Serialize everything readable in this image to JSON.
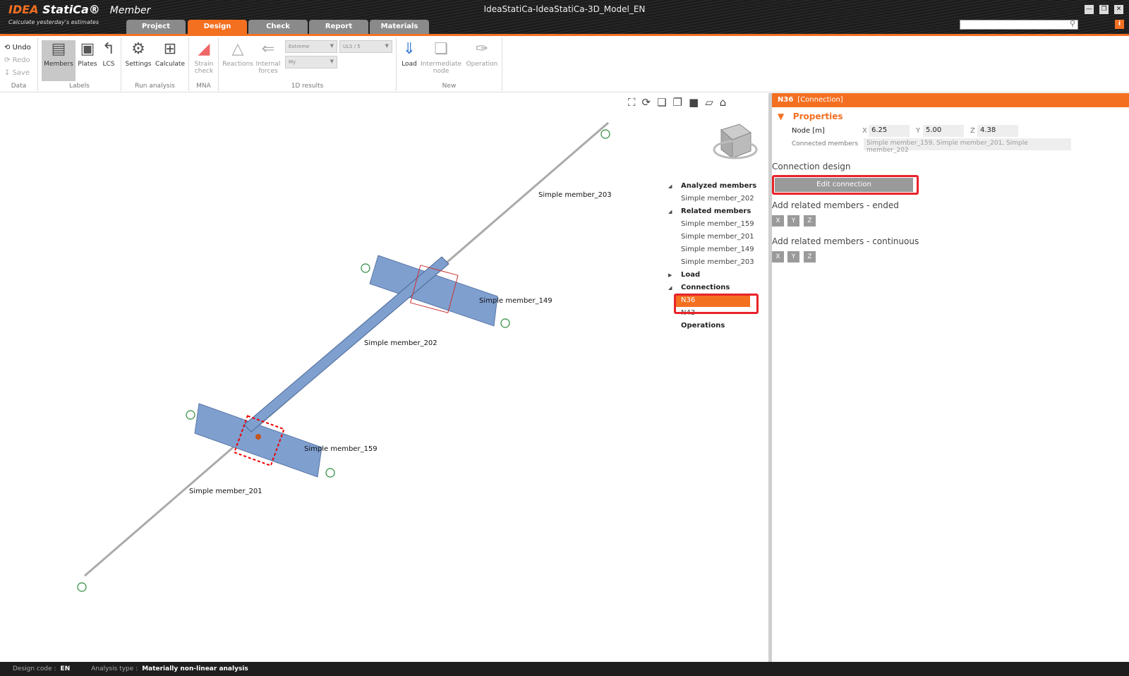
{
  "app": {
    "brand_idea": "IDEA",
    "brand_statica": "StatiCa®",
    "product": "Member",
    "tagline": "Calculate yesterday's estimates",
    "title": "IdeaStatiCa-IdeaStatiCa-3D_Model_EN"
  },
  "tabs": [
    {
      "label": "Project"
    },
    {
      "label": "Design"
    },
    {
      "label": "Check"
    },
    {
      "label": "Report"
    },
    {
      "label": "Materials"
    }
  ],
  "ribbon": {
    "data": {
      "undo": "Undo",
      "redo": "Redo",
      "save": "Save",
      "label": "Data"
    },
    "labels": {
      "members": "Members",
      "plates": "Plates",
      "lcs": "LCS",
      "label": "Labels"
    },
    "run": {
      "settings": "Settings",
      "calculate": "Calculate",
      "label": "Run analysis"
    },
    "mna": {
      "strain1": "Strain",
      "strain2": "check",
      "label": "MNA"
    },
    "results": {
      "reactions": "Reactions",
      "internal1": "Internal",
      "internal2": "forces",
      "dd1": "Extreme",
      "dd2": "ULS / 5",
      "dd3": "My",
      "label": "1D results"
    },
    "new": {
      "load": "Load",
      "inter1": "Intermediate",
      "inter2": "node",
      "operation": "Operation",
      "label": "New"
    }
  },
  "model": {
    "labels": [
      "Simple member_203",
      "Simple member_149",
      "Simple member_202",
      "Simple member_159",
      "Simple member_201"
    ]
  },
  "tree": {
    "analyzed": "Analyzed members",
    "analyzed_items": [
      "Simple member_202"
    ],
    "related": "Related members",
    "related_items": [
      "Simple member_159",
      "Simple member_201",
      "Simple member_149",
      "Simple member_203"
    ],
    "load": "Load",
    "connections": "Connections",
    "connection_items": [
      "N36",
      "N43"
    ],
    "operations": "Operations"
  },
  "panel": {
    "name": "N36",
    "type": "[Connection]",
    "properties": "Properties",
    "node_label": "Node [m]",
    "x": "6.25",
    "y": "5.00",
    "z": "4.38",
    "connected_label": "Connected members",
    "connected_value": "Simple member_159, Simple member_201, Simple member_202",
    "connection_design": "Connection design",
    "edit_connection": "Edit connection",
    "ended": "Add related members - ended",
    "continuous": "Add related members - continuous",
    "axes": [
      "X",
      "Y",
      "Z"
    ]
  },
  "status": {
    "design_code_label": "Design code :",
    "design_code": "EN",
    "analysis_label": "Analysis type :",
    "analysis": "Materially non-linear analysis"
  },
  "colors": {
    "accent": "#f37021",
    "highlight": "#e8232a",
    "beam": "#7f9fcf"
  }
}
